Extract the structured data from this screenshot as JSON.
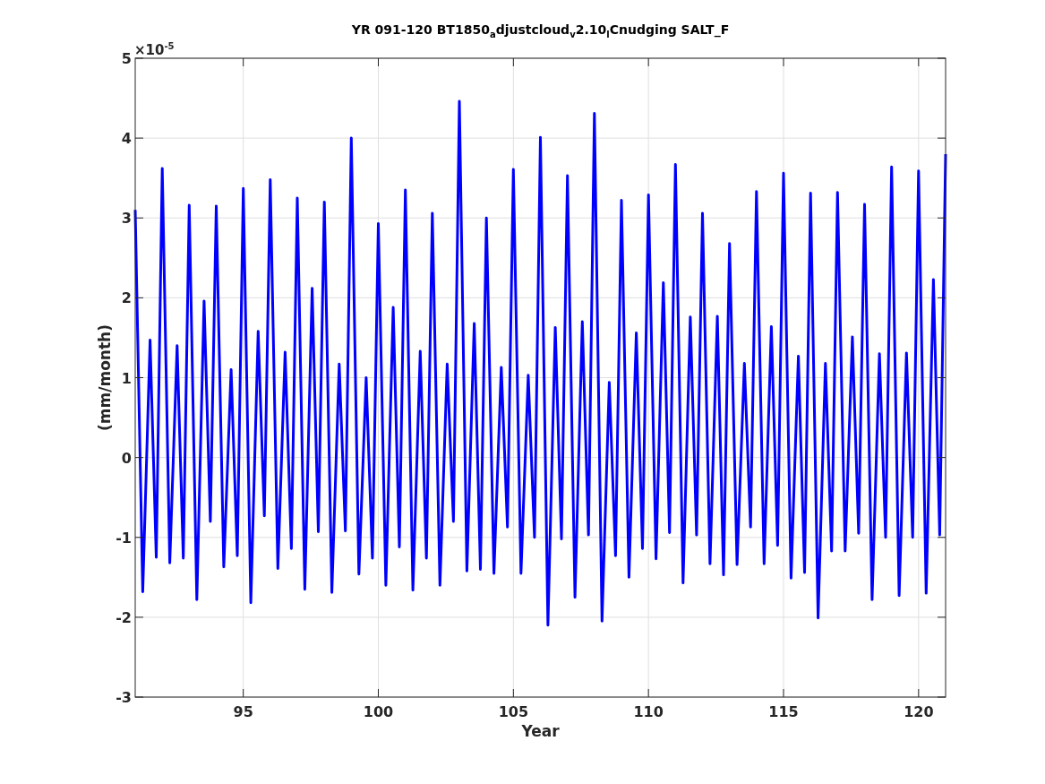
{
  "figure": {
    "y_multiplier": "×10$^{-5}$",
    "chart_data": {
      "type": "line",
      "title": "YR 091-120 BT1850$_{a}$djustcloud$_{v}$2.10$_{l}$Cnudging SALT_F",
      "xlabel": "Year",
      "ylabel": "(mm/month)",
      "x": [
        91,
        91.28,
        91.55,
        91.78,
        92,
        92.28,
        92.55,
        92.78,
        93,
        93.28,
        93.55,
        93.78,
        94,
        94.28,
        94.55,
        94.78,
        95,
        95.28,
        95.55,
        95.78,
        96,
        96.28,
        96.55,
        96.78,
        97,
        97.28,
        97.55,
        97.78,
        98,
        98.28,
        98.55,
        98.78,
        99,
        99.28,
        99.55,
        99.78,
        100,
        100.28,
        100.55,
        100.78,
        101,
        101.28,
        101.55,
        101.78,
        102,
        102.28,
        102.55,
        102.78,
        103,
        103.28,
        103.55,
        103.78,
        104,
        104.28,
        104.55,
        104.78,
        105,
        105.28,
        105.55,
        105.78,
        106,
        106.28,
        106.55,
        106.78,
        107,
        107.28,
        107.55,
        107.78,
        108,
        108.28,
        108.55,
        108.78,
        109,
        109.28,
        109.55,
        109.78,
        110,
        110.28,
        110.55,
        110.78,
        111,
        111.28,
        111.55,
        111.78,
        112,
        112.28,
        112.55,
        112.78,
        113,
        113.28,
        113.55,
        113.78,
        114,
        114.28,
        114.55,
        114.78,
        115,
        115.28,
        115.55,
        115.78,
        116,
        116.28,
        116.55,
        116.78,
        117,
        117.28,
        117.55,
        117.78,
        118,
        118.28,
        118.55,
        118.78,
        119,
        119.28,
        119.55,
        119.78,
        120,
        120.28,
        120.55,
        120.78,
        121
      ],
      "series": [
        {
          "color": "#0000ff",
          "values": [
            3.1,
            -1.68,
            1.47,
            -1.25,
            3.62,
            -1.32,
            1.4,
            -1.26,
            3.16,
            -1.78,
            1.96,
            -0.8,
            3.15,
            -1.37,
            1.1,
            -1.23,
            3.37,
            -1.82,
            1.58,
            -0.73,
            3.48,
            -1.39,
            1.32,
            -1.14,
            3.25,
            -1.65,
            2.12,
            -0.93,
            3.2,
            -1.69,
            1.17,
            -0.92,
            4.0,
            -1.46,
            1.0,
            -1.26,
            2.93,
            -1.6,
            1.88,
            -1.12,
            3.35,
            -1.66,
            1.33,
            -1.26,
            3.06,
            -1.6,
            1.17,
            -0.8,
            4.46,
            -1.42,
            1.68,
            -1.4,
            3.0,
            -1.45,
            1.13,
            -0.87,
            3.61,
            -1.45,
            1.03,
            -1.0,
            4.01,
            -2.1,
            1.63,
            -1.02,
            3.53,
            -1.75,
            1.7,
            -0.97,
            4.31,
            -2.05,
            0.94,
            -1.23,
            3.22,
            -1.5,
            1.56,
            -1.14,
            3.29,
            -1.27,
            2.19,
            -0.94,
            3.67,
            -1.57,
            1.76,
            -0.97,
            3.06,
            -1.33,
            1.77,
            -1.47,
            2.68,
            -1.34,
            1.18,
            -0.87,
            3.33,
            -1.33,
            1.64,
            -1.1,
            3.56,
            -1.51,
            1.27,
            -1.44,
            3.31,
            -2.01,
            1.18,
            -1.17,
            3.32,
            -1.17,
            1.51,
            -0.95,
            3.17,
            -1.78,
            1.3,
            -1.0,
            3.64,
            -1.73,
            1.31,
            -1.0,
            3.59,
            -1.7,
            2.23,
            -0.97,
            3.8
          ]
        }
      ],
      "grid": true,
      "xlim": [
        91,
        121
      ],
      "ylim": [
        -3,
        5
      ],
      "xticks": [
        95,
        100,
        105,
        110,
        115,
        120
      ],
      "yticks": [
        -3,
        -2,
        -1,
        0,
        1,
        2,
        3,
        4,
        5
      ]
    }
  }
}
